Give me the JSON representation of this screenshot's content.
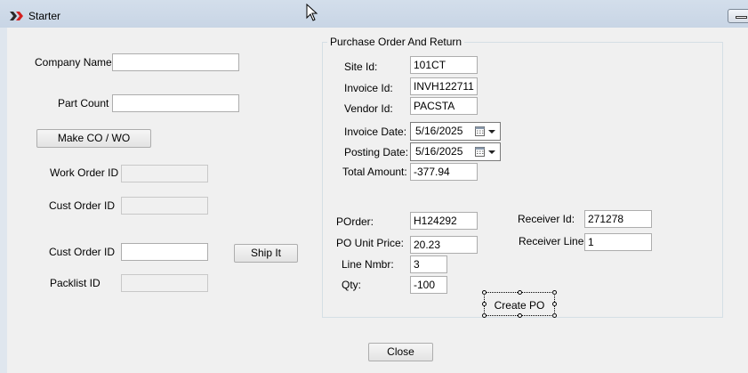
{
  "window": {
    "title": "Starter"
  },
  "icons": {
    "app": "red-chevrons-icon",
    "window_button": "restore-icon",
    "calendar": "calendar-icon",
    "cursor": "mouse-pointer-icon"
  },
  "left": {
    "company_name_label": "Company Name",
    "company_name_value": "",
    "part_count_label": "Part Count",
    "part_count_value": "",
    "make_button": "Make CO / WO",
    "work_order_label": "Work Order ID",
    "work_order_value": "",
    "cust_order_label_1": "Cust Order ID",
    "cust_order_value_1": "",
    "cust_order_label_2": "Cust Order ID",
    "cust_order_value_2": "",
    "ship_button": "Ship It",
    "packlist_label": "Packlist ID",
    "packlist_value": ""
  },
  "group": {
    "title": "Purchase Order And Return",
    "site_id_label": "Site Id:",
    "site_id": "101CT",
    "invoice_id_label": "Invoice Id:",
    "invoice_id": "INVH122711",
    "vendor_id_label": "Vendor Id:",
    "vendor_id": "PACSTA",
    "invoice_date_label": "Invoice Date:",
    "invoice_date": "5/16/2025",
    "posting_date_label": "Posting Date:",
    "posting_date": "5/16/2025",
    "total_amount_label": "Total Amount:",
    "total_amount": "-377.94",
    "porder_label": "POrder:",
    "porder": "H124292",
    "po_unit_price_label": "PO Unit Price:",
    "po_unit_price": "20.23",
    "line_nmbr_label": "Line Nmbr:",
    "line_nmbr": "3",
    "qty_label": "Qty:",
    "qty": "-100",
    "receiver_id_label": "Receiver Id:",
    "receiver_id": "271278",
    "receiver_line_label": "Receiver Line:",
    "receiver_line": "1",
    "create_po_button": "Create PO"
  },
  "close_button": "Close"
}
